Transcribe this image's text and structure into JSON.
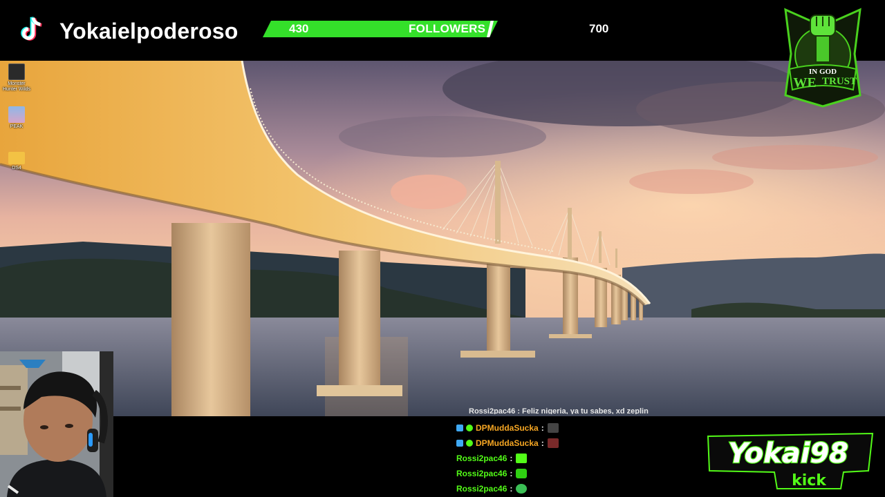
{
  "header": {
    "platform_icon": "tiktok-icon",
    "channel_name": "Yokaielpoderoso",
    "goal": {
      "current": "430",
      "label": "FOLLOWERS",
      "target": "700",
      "progress_fraction": 0.614
    },
    "colors": {
      "goal_bar": "#34e02a",
      "kick_green": "#53fc18"
    }
  },
  "desktop": {
    "icons": [
      {
        "name": "monster-hunter-wilds-icon",
        "label": "Monster Hunter Wilds"
      },
      {
        "name": "peak-icon",
        "label": "PEAK"
      },
      {
        "name": "folder-icon",
        "label": "DS4"
      }
    ],
    "wallpaper": "bridge-at-sunset"
  },
  "emblem": {
    "icon": "raised-fist-icon",
    "line1": "IN GOD",
    "line2a": "WE",
    "line2b": "TRUST"
  },
  "chat": {
    "cut_line": "Rossi2pac46 : Feliz nigeria, ya tu sabes, xd zeplin",
    "messages": [
      {
        "user": "DPMuddaSucka",
        "color": "gold",
        "badges": true,
        "emote": "name-tag-emote"
      },
      {
        "user": "DPMuddaSucka",
        "color": "gold",
        "badges": true,
        "emote": "mudda-emote"
      },
      {
        "user": "Rossi2pac46",
        "color": "green",
        "badges": false,
        "emote": "kick-emote"
      },
      {
        "user": "Rossi2pac46",
        "color": "green",
        "badges": false,
        "emote": "kick-k-emote"
      },
      {
        "user": "Rossi2pac46",
        "color": "green",
        "badges": false,
        "emote": "green-blob-emote"
      }
    ],
    "separator": ":"
  },
  "branding": {
    "name": "Yokai98",
    "platform": "kick"
  }
}
